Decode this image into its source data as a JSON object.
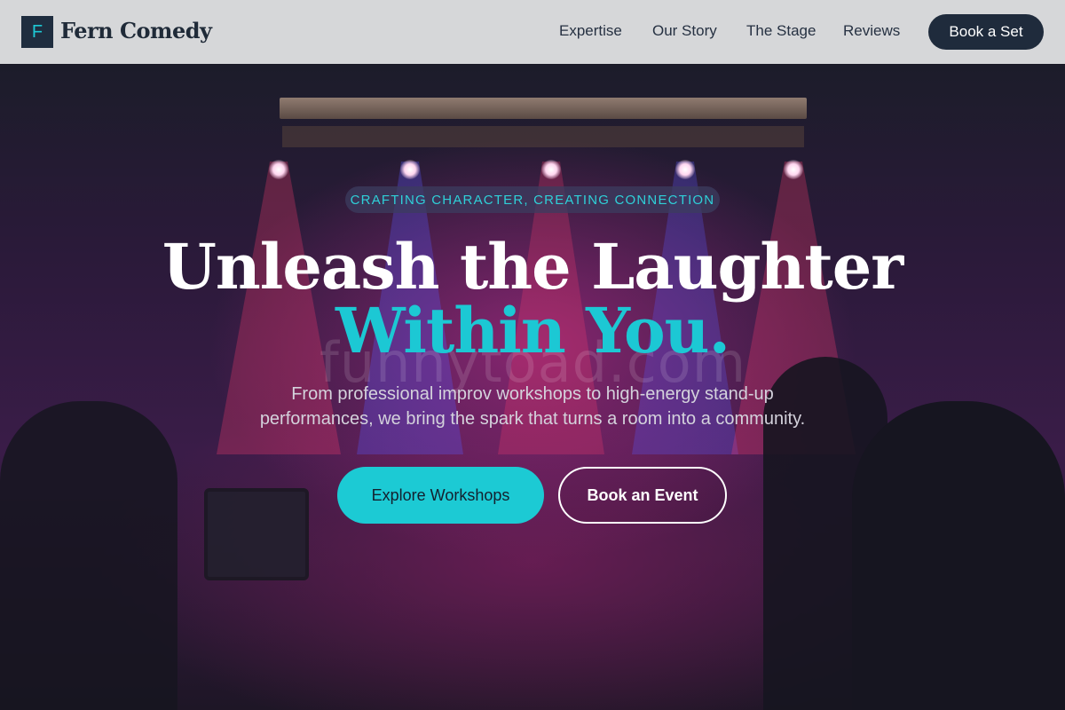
{
  "nav": {
    "logo_letter": "F",
    "brand": "Fern Comedy",
    "links": [
      "Expertise",
      "Our Story",
      "The Stage",
      "Reviews"
    ],
    "cta": "Book a Set"
  },
  "hero": {
    "tagline": "CRAFTING CHARACTER, CREATING CONNECTION",
    "title_line1": "Unleash the Laughter",
    "title_line2": "Within You.",
    "subtitle_line1": "From professional improv workshops to high-energy stand-up",
    "subtitle_line2": "performances, we bring the spark that turns a room into a community.",
    "primary_button": "Explore Workshops",
    "secondary_button": "Book an Event",
    "watermark": "funnytoad.com"
  },
  "colors": {
    "accent": "#1cc8d4",
    "nav_background": "#d6d7d9",
    "dark": "#1f2b3c"
  }
}
